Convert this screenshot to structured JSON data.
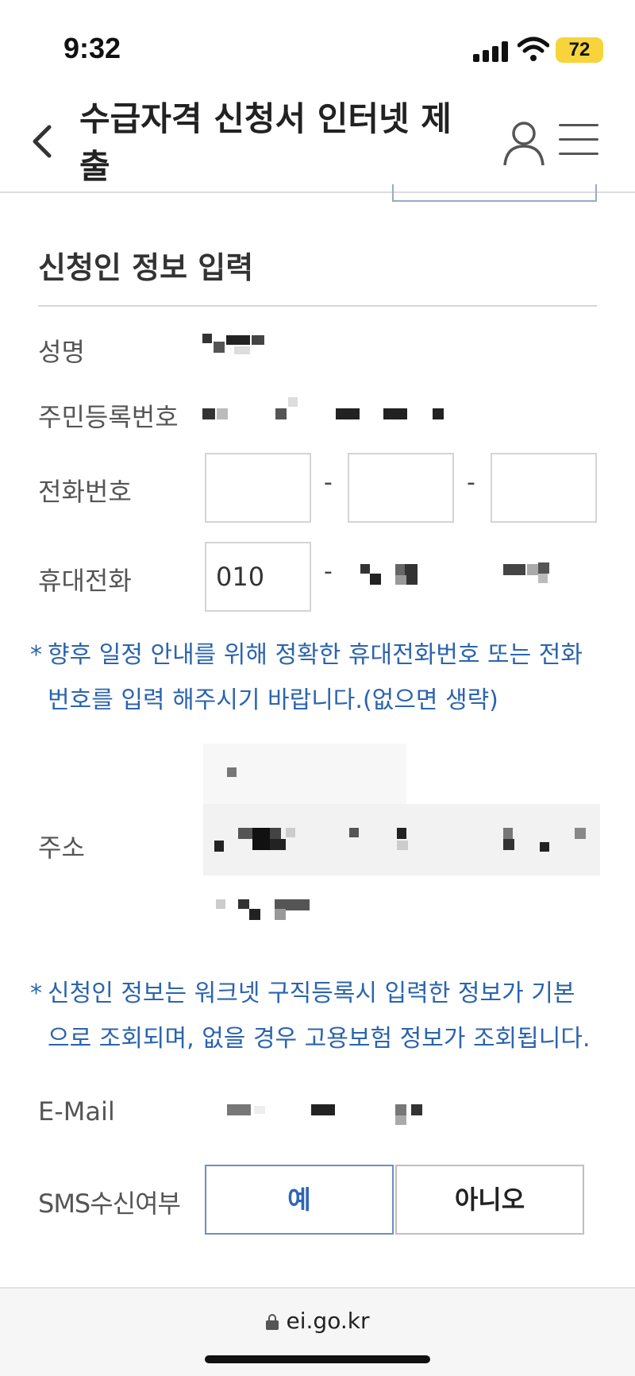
{
  "status": {
    "time": "9:32",
    "battery": "72"
  },
  "header": {
    "title": "수급자격 신청서 인터넷 제출"
  },
  "section": {
    "title": "신청인 정보 입력"
  },
  "fields": {
    "name_label": "성명",
    "rrn_label": "주민등록번호",
    "phone_label": "전화번호",
    "mobile_label": "휴대전화",
    "mobile_prefix": "010",
    "address_label": "주소",
    "email_label": "E-Mail",
    "sms_label": "SMS수신여부"
  },
  "notices": {
    "phone_notice_1": "향후 일정 안내를 위해 정확한 휴대전화번호 또는 전화",
    "phone_notice_2": "번호를 입력 해주시기 바랍니다.(없으면 생략)",
    "info_notice_1": "신청인 정보는 워크넷 구직등록시 입력한 정보가 기본",
    "info_notice_2": "으로 조회되며, 없을 경우 고용보험 정보가 조회됩니다.",
    "star": "*"
  },
  "sms": {
    "yes_label": "예",
    "no_label": "아니오",
    "selected": "yes"
  },
  "browser": {
    "url": "ei.go.kr"
  },
  "colors": {
    "accent": "#2f66b3",
    "notice": "#2b64ad"
  }
}
